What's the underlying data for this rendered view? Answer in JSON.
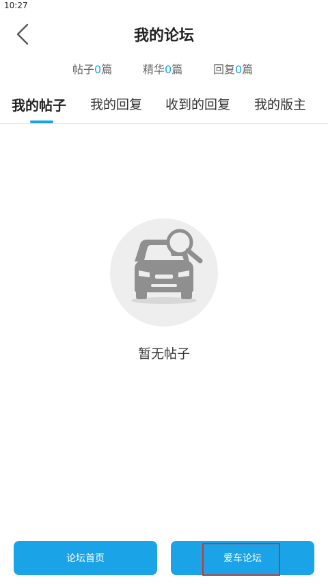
{
  "status_bar": {
    "time": "10:27"
  },
  "header": {
    "title": "我的论坛",
    "back_icon": "chevron-left-icon"
  },
  "stats": [
    {
      "label": "帖子",
      "count": "0",
      "unit": "篇"
    },
    {
      "label": "精华",
      "count": "0",
      "unit": "篇"
    },
    {
      "label": "回复",
      "count": "0",
      "unit": "篇"
    }
  ],
  "tabs": [
    {
      "label": "我的帖子",
      "active": true
    },
    {
      "label": "我的回复",
      "active": false
    },
    {
      "label": "收到的回复",
      "active": false
    },
    {
      "label": "我的版主",
      "active": false
    }
  ],
  "empty_state": {
    "icon": "car-search-icon",
    "text": "暂无帖子"
  },
  "bottom_buttons": {
    "home": "论坛首页",
    "car": "爱车论坛"
  },
  "colors": {
    "accent": "#1ba3e8",
    "highlight": "#d0342c",
    "icon_gray": "#8f8f8f"
  }
}
